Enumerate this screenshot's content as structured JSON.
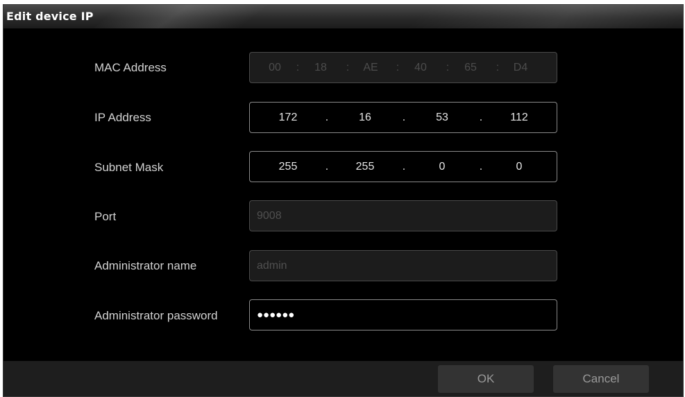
{
  "dialog": {
    "title": "Edit device IP",
    "fields": {
      "mac": {
        "label": "MAC Address",
        "segments": [
          "00",
          "18",
          "AE",
          "40",
          "65",
          "D4"
        ],
        "separator": ":",
        "disabled": true
      },
      "ip": {
        "label": "IP Address",
        "octets": [
          "172",
          "16",
          "53",
          "112"
        ],
        "separator": "."
      },
      "subnet": {
        "label": "Subnet Mask",
        "octets": [
          "255",
          "255",
          "0",
          "0"
        ],
        "separator": "."
      },
      "port": {
        "label": "Port",
        "value": "9008",
        "disabled": true
      },
      "admin_name": {
        "label": "Administrator name",
        "value": "admin",
        "disabled": true
      },
      "admin_password": {
        "label": "Administrator password",
        "value": "●●●●●●"
      }
    },
    "buttons": {
      "ok": "OK",
      "cancel": "Cancel"
    }
  }
}
